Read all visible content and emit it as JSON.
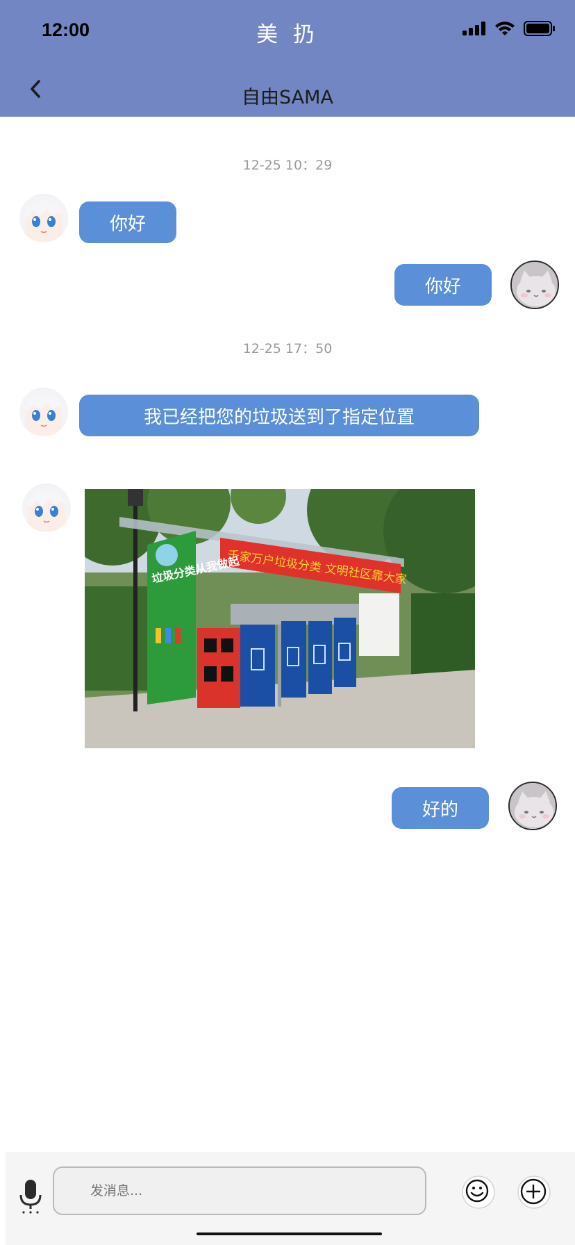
{
  "status_bar": {
    "time": "12:00"
  },
  "app": {
    "title": "美 扔"
  },
  "header": {
    "chat_title": "自由SAMA"
  },
  "messages": [
    {
      "type": "timestamp",
      "text": "12-25 10：29"
    },
    {
      "type": "text",
      "from": "other",
      "text": "你好"
    },
    {
      "type": "text",
      "from": "self",
      "text": "你好"
    },
    {
      "type": "timestamp",
      "text": "12-25 17：50"
    },
    {
      "type": "text",
      "from": "other",
      "text": "我已经把您的垃圾送到了指定位置"
    },
    {
      "type": "image",
      "from": "other"
    },
    {
      "type": "text",
      "from": "self",
      "text": "好的"
    }
  ],
  "photo": {
    "sign_text": "垃圾分类从我做起",
    "banner_text": "千家万户垃圾分类 文明社区靠大家"
  },
  "input": {
    "placeholder": "发消息..."
  },
  "icons": {
    "back": "chevron-left-icon",
    "mic": "microphone-icon",
    "emoji": "smile-icon",
    "plus": "plus-circle-icon"
  },
  "colors": {
    "header": "#7186c2",
    "bubble": "#5b8fd8",
    "input_bar": "#f5f5f5"
  }
}
